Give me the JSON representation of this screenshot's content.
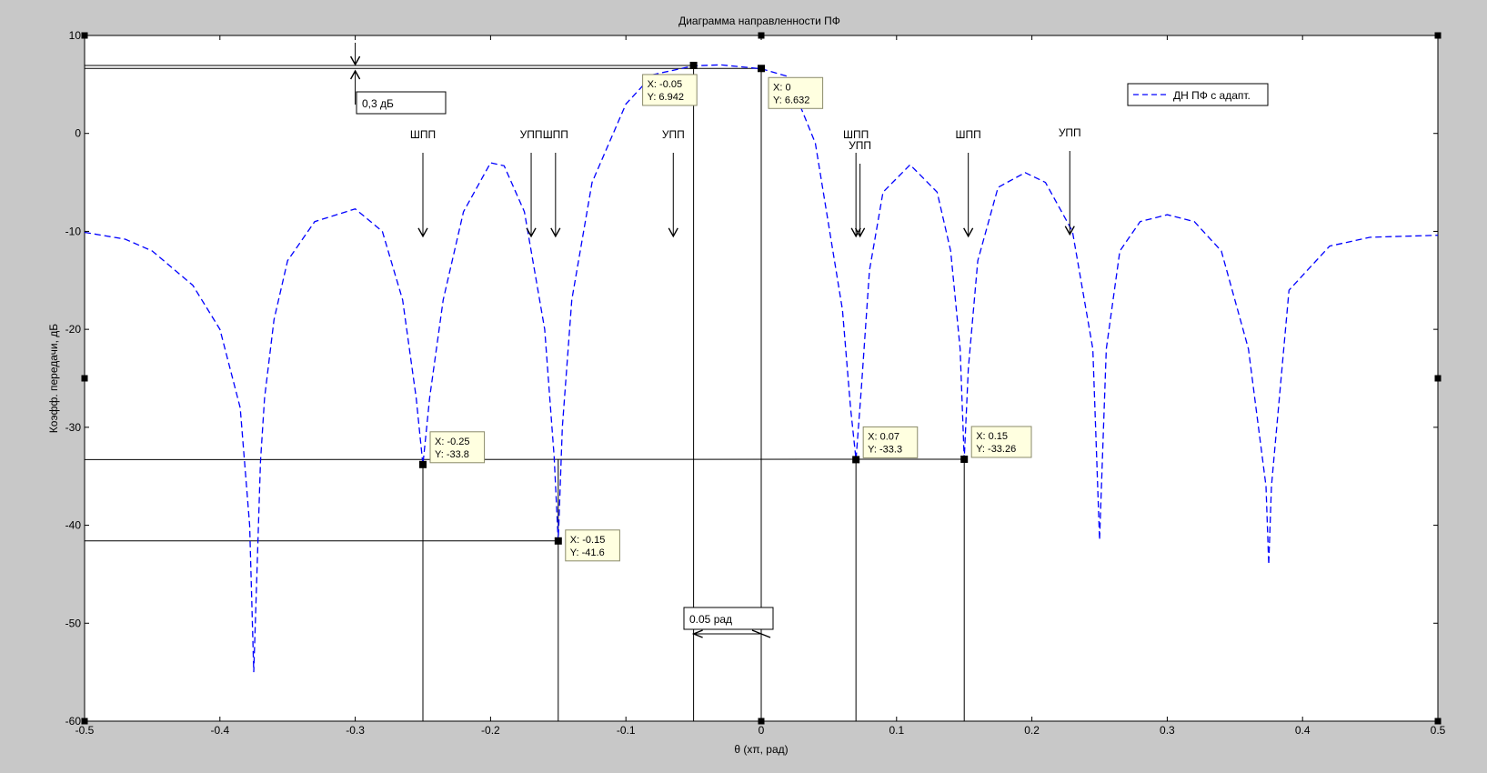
{
  "chart_data": {
    "type": "line",
    "title": "Диаграмма направленности ПФ",
    "xlabel": "θ (хπ, рад)",
    "ylabel": "Коэфф. передачи, дБ",
    "xlim": [
      -0.5,
      0.5
    ],
    "ylim": [
      -60,
      10
    ],
    "xticks": [
      -0.5,
      -0.4,
      -0.3,
      -0.2,
      -0.1,
      0,
      0.1,
      0.2,
      0.3,
      0.4,
      0.5
    ],
    "xtick_labels": [
      "-0.5",
      "-0.4",
      "-0.3",
      "-0.2",
      "-0.1",
      "0",
      "0.1",
      "0.2",
      "0.3",
      "0.4",
      "0.5"
    ],
    "yticks": [
      10,
      0,
      -10,
      -20,
      -30,
      -40,
      -50,
      -60
    ],
    "ytick_labels": [
      "10",
      "0",
      "-10",
      "-20",
      "-30",
      "-40",
      "-50",
      "-60"
    ],
    "grid": false,
    "legend_position": "top-right",
    "series": [
      {
        "name": "ДН ПФ с адапт.",
        "color": "#0000ff",
        "style": "dashed",
        "x": [
          -0.5,
          -0.47,
          -0.45,
          -0.42,
          -0.4,
          -0.385,
          -0.378,
          -0.375,
          -0.372,
          -0.37,
          -0.367,
          -0.36,
          -0.35,
          -0.33,
          -0.3,
          -0.28,
          -0.265,
          -0.255,
          -0.25,
          -0.245,
          -0.235,
          -0.22,
          -0.2,
          -0.19,
          -0.175,
          -0.16,
          -0.153,
          -0.15,
          -0.147,
          -0.14,
          -0.125,
          -0.1,
          -0.08,
          -0.05,
          -0.03,
          0,
          0.02,
          0.04,
          0.06,
          0.066,
          0.07,
          0.074,
          0.08,
          0.09,
          0.11,
          0.13,
          0.14,
          0.147,
          0.15,
          0.153,
          0.16,
          0.175,
          0.195,
          0.21,
          0.23,
          0.245,
          0.25,
          0.255,
          0.265,
          0.28,
          0.3,
          0.32,
          0.34,
          0.36,
          0.373,
          0.375,
          0.377,
          0.39,
          0.42,
          0.45,
          0.5
        ],
        "y": [
          -10.1,
          -10.8,
          -12,
          -15.5,
          -20,
          -28,
          -40,
          -55,
          -42,
          -33.5,
          -27,
          -19,
          -13,
          -9,
          -7.7,
          -10,
          -17,
          -27,
          -33.8,
          -27,
          -17,
          -8,
          -3,
          -3.3,
          -8,
          -20,
          -33,
          -41.6,
          -30,
          -17,
          -5,
          3,
          6,
          6.9,
          7,
          6.6,
          5.8,
          -1,
          -18,
          -28,
          -33.3,
          -26,
          -14,
          -6,
          -3.2,
          -6,
          -12,
          -22,
          -33.26,
          -24,
          -13,
          -5.5,
          -4,
          -5,
          -10,
          -22,
          -41.5,
          -22,
          -12,
          -9,
          -8.3,
          -9,
          -12,
          -22,
          -36,
          -44,
          -36,
          -16,
          -11.5,
          -10.6,
          -10.4
        ]
      }
    ],
    "datatips": [
      {
        "x": -0.05,
        "y": 6.942,
        "text_x": "X: -0.05",
        "text_y": "Y: 6.942"
      },
      {
        "x": 0,
        "y": 6.632,
        "text_x": "X: 0",
        "text_y": "Y: 6.632"
      },
      {
        "x": -0.25,
        "y": -33.8,
        "text_x": "X: -0.25",
        "text_y": "Y: -33.8"
      },
      {
        "x": -0.15,
        "y": -41.6,
        "text_x": "X: -0.15",
        "text_y": "Y: -41.6"
      },
      {
        "x": 0.07,
        "y": -33.3,
        "text_x": "X: 0.07",
        "text_y": "Y: -33.3"
      },
      {
        "x": 0.15,
        "y": -33.26,
        "text_x": "X: 0.15",
        "text_y": "Y: -33.26"
      }
    ],
    "annotations": [
      {
        "text": "ШПП",
        "x": -0.25
      },
      {
        "text": "УПП",
        "x": -0.17
      },
      {
        "text": "ШПП",
        "x": -0.152
      },
      {
        "text": "УПП",
        "x": -0.065
      },
      {
        "text": "ШПП",
        "x": 0.07
      },
      {
        "text": "УПП",
        "x": 0.073
      },
      {
        "text": "ШПП",
        "x": 0.153
      },
      {
        "text": "УПП",
        "x": 0.228
      }
    ],
    "text_boxes": [
      {
        "text": "0,3 дБ"
      },
      {
        "text": "0.05 рад"
      }
    ]
  }
}
